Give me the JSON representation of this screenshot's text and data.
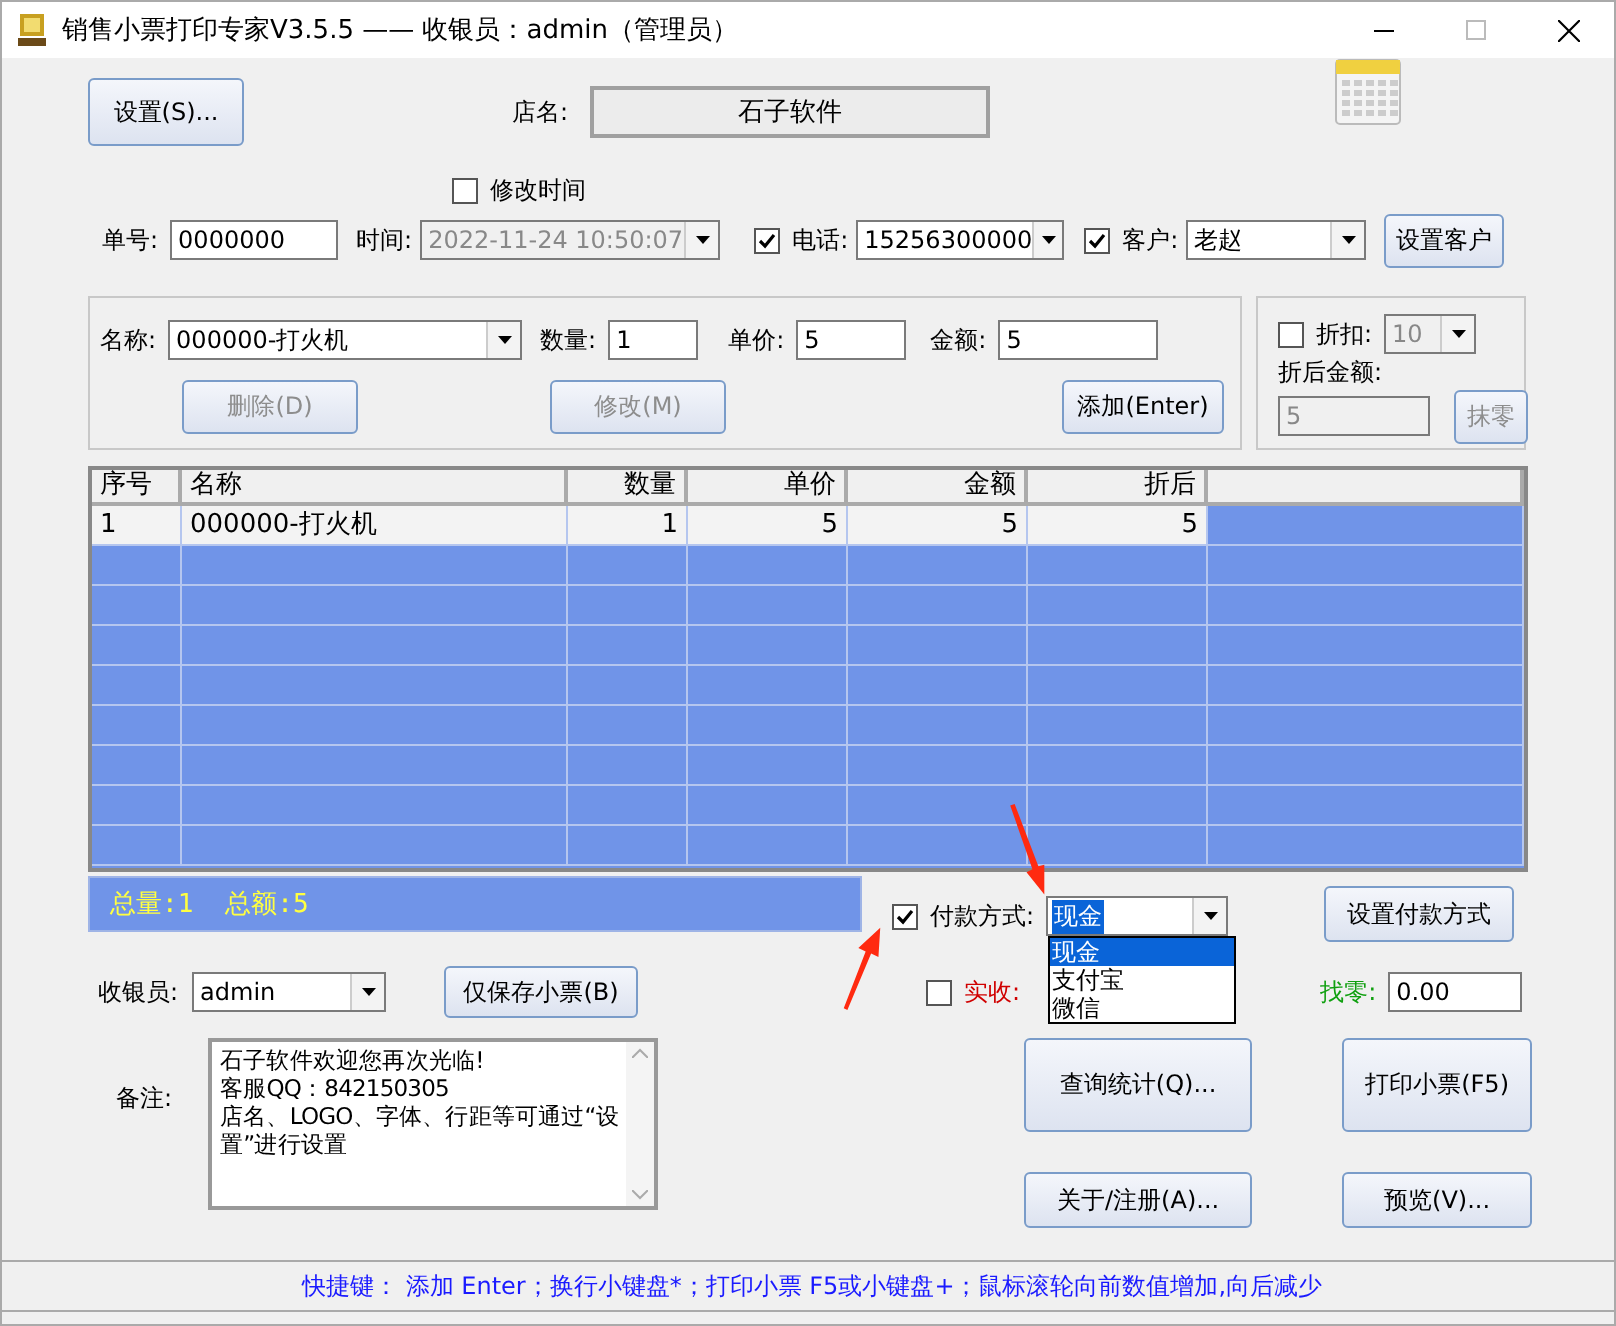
{
  "window": {
    "title": "销售小票打印专家V3.5.5 —— 收银员：admin（管理员）"
  },
  "header": {
    "settings_button": "设置(S)...",
    "shop_label": "店名:",
    "shop_name": "石子软件"
  },
  "modify_time": {
    "label": "修改时间",
    "checked": false
  },
  "order": {
    "number_label": "单号:",
    "number": "0000000",
    "time_label": "时间:",
    "time": "2022-11-24 10:50:07",
    "time_disabled": true,
    "phone_label": "电话:",
    "phone_checked": true,
    "phone": "15256300000",
    "customer_label": "客户:",
    "customer_checked": true,
    "customer": "老赵",
    "set_customer_button": "设置客户"
  },
  "item": {
    "name_label": "名称:",
    "name": "000000-打火机",
    "qty_label": "数量:",
    "qty": "1",
    "price_label": "单价:",
    "price": "5",
    "amount_label": "金额:",
    "amount": "5",
    "buttons": [
      {
        "label": "删除(D)",
        "disabled": true
      },
      {
        "label": "修改(M)",
        "disabled": true
      },
      {
        "label": "添加(Enter)",
        "disabled": false
      }
    ]
  },
  "discount": {
    "label": "折扣:",
    "checked": false,
    "value": "10",
    "after_label": "折后金额:",
    "after_value": "5",
    "round_button": "抹零",
    "disabled": true
  },
  "table": {
    "columns": [
      "序号",
      "名称",
      "数量",
      "单价",
      "金额",
      "折后"
    ],
    "rows": [
      {
        "cells": [
          "1",
          "000000-打火机",
          "1",
          "5",
          "5",
          "5"
        ],
        "selected": false
      }
    ]
  },
  "summary": [
    "总量:1",
    "总额:5"
  ],
  "payment": {
    "label": "付款方式:",
    "checked": true,
    "value": "现金",
    "expanded": true,
    "set_button": "设置付款方式",
    "options": [
      {
        "label": "现金",
        "selected": true
      },
      {
        "label": "支付宝",
        "selected": false
      },
      {
        "label": "微信",
        "selected": false
      }
    ]
  },
  "cashier": {
    "label": "收银员:",
    "value": "admin",
    "save_button": "仅保存小票(B)"
  },
  "received": {
    "label": "实收:",
    "checked": false
  },
  "change": {
    "label": "找零:",
    "value": "0.00"
  },
  "memo": {
    "label": "备注:",
    "text": "石子软件欢迎您再次光临!\n客服QQ：842150305\n店名、LOGO、字体、行距等可通过“设置”进行设置"
  },
  "actions": [
    "查询统计(Q)...",
    "打印小票(F5)",
    "关于/注册(A)...",
    "预览(V)..."
  ],
  "status_bar": "快捷键： 添加 Enter；换行小键盘*；打印小票 F5或小键盘+；鼠标滚轮向前数值增加,向后减少"
}
